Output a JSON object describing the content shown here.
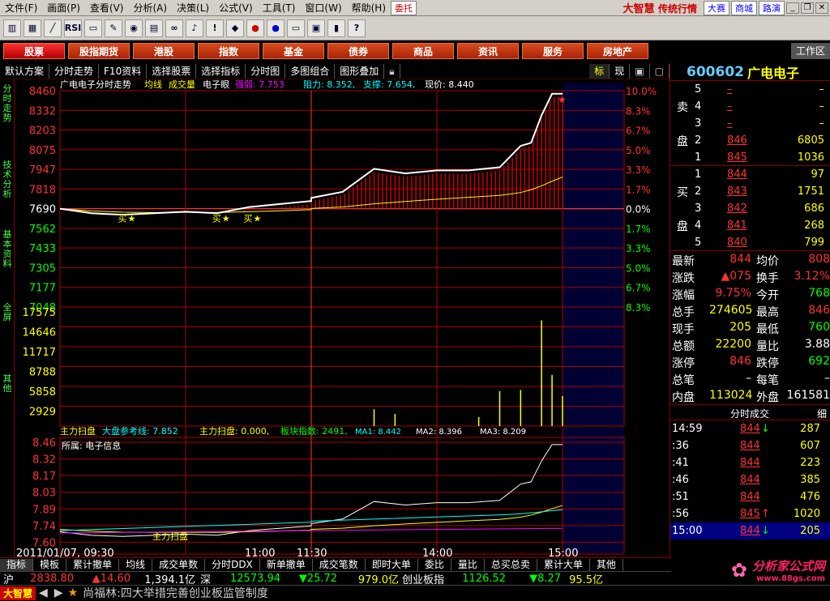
{
  "menu": [
    "文件(F)",
    "画面(P)",
    "查看(V)",
    "分析(A)",
    "决策(L)",
    "公式(V)",
    "工具(T)",
    "窗口(W)",
    "帮助(H)"
  ],
  "menu_right": {
    "entrust": "委托",
    "logo": "大智慧",
    "logo_sub": "传统行情",
    "btn1": "大赛",
    "btn2": "商城",
    "btn3": "路演"
  },
  "nav": [
    "股票",
    "股指期货",
    "港股",
    "指数",
    "基金",
    "债券",
    "商品",
    "资讯",
    "服务",
    "房地产"
  ],
  "workspace": "工作区",
  "options": [
    "默认方案",
    "分时走势",
    "F10资料",
    "选择股票",
    "选择指标",
    "分时图",
    "多图组合",
    "图形叠加"
  ],
  "side_tabs": [
    "分时走势",
    "技术分析",
    "基本资料",
    "全屏",
    "其他"
  ],
  "chart_header": {
    "a": "广电电子分时走势",
    "b": "均线",
    "c": "成交量",
    "d": "电子眼",
    "e": "强弱: 7.753",
    "f": "阻力: 8.352,",
    "g": "支撑: 7.654,",
    "h": "现价: 8.440"
  },
  "y_left_price": [
    "8460",
    "8332",
    "8203",
    "8075",
    "7947",
    "7818",
    "7690",
    "7562",
    "7433",
    "7305",
    "7177",
    "7048"
  ],
  "y_right_pct": [
    "10.0%",
    "8.3%",
    "6.7%",
    "5.0%",
    "3.3%",
    "1.7%",
    "0.0%",
    "1.7%",
    "3.3%",
    "5.0%",
    "6.7%",
    "8.3%"
  ],
  "y_vol": [
    "17575",
    "14646",
    "11717",
    "8788",
    "5858",
    "2929"
  ],
  "ind_header": {
    "a": "主力扫盘",
    "b": "大盘参考线: 7.852",
    "c": "主力扫盘: 0.000,",
    "d": "板块指数: 2491,",
    "e": "MA1: 8.442",
    "f": "MA2: 8.396",
    "g": "MA3: 8.209"
  },
  "ind_sector": "所属: 电子信息",
  "ind_label": "主力扫盘",
  "y_ind": [
    "8.46",
    "8.32",
    "8.17",
    "8.03",
    "7.89",
    "7.74",
    "7.60"
  ],
  "x_labels": [
    "2011/01/07, 09:30",
    "11:00",
    "11:30",
    "14:00",
    "15:00"
  ],
  "buy_marks": [
    "买",
    "买",
    "买"
  ],
  "quote": {
    "code": "600602",
    "name": "广电电子",
    "sell_label": [
      "卖",
      "盘"
    ],
    "buy_label": [
      "买",
      "盘"
    ],
    "asks": [
      [
        "5",
        "–",
        "–"
      ],
      [
        "4",
        "–",
        "–"
      ],
      [
        "3",
        "–",
        "–"
      ],
      [
        "2",
        "846",
        "6805"
      ],
      [
        "1",
        "845",
        "1036"
      ]
    ],
    "bids": [
      [
        "1",
        "844",
        "97"
      ],
      [
        "2",
        "843",
        "1751"
      ],
      [
        "3",
        "842",
        "686"
      ],
      [
        "4",
        "841",
        "268"
      ],
      [
        "5",
        "840",
        "799"
      ]
    ],
    "stats": [
      [
        "最新",
        "844",
        "均价",
        "808"
      ],
      [
        "涨跌",
        "▲075",
        "换手",
        "3.12%"
      ],
      [
        "涨幅",
        "9.75%",
        "今开",
        "768"
      ],
      [
        "总手",
        "274605",
        "最高",
        "846"
      ],
      [
        "现手",
        "205",
        "最低",
        "760"
      ],
      [
        "总额",
        "22200",
        "量比",
        "3.88"
      ],
      [
        "涨停",
        "846",
        "跌停",
        "692"
      ],
      [
        "总笔",
        "–",
        "每笔",
        "–"
      ],
      [
        "内盘",
        "113024",
        "外盘",
        "161581"
      ]
    ],
    "ticks_title": "分时成交",
    "ticks_tab": "细",
    "ticks": [
      [
        "14:59",
        "844",
        "↓",
        "287"
      ],
      [
        ":36",
        "844",
        "",
        "607"
      ],
      [
        ":41",
        "844",
        "",
        "223"
      ],
      [
        ":46",
        "844",
        "",
        "385"
      ],
      [
        ":51",
        "844",
        "",
        "476"
      ],
      [
        ":56",
        "845",
        "↑",
        "1020"
      ],
      [
        "15:00",
        "844",
        "↓",
        "205"
      ]
    ]
  },
  "bottom_tabs": [
    "指标",
    "模板",
    "累计撤单",
    "均线",
    "成交单数",
    "分时DDX",
    "新单撤单",
    "成交笔数",
    "即时大单",
    "委比",
    "量比",
    "总买总卖",
    "累计大单",
    "其他"
  ],
  "index_bar": {
    "sh": "沪",
    "sh_val": "2838.80",
    "sh_chg": "▲14.60",
    "sh_amt": "1,394.1亿",
    "sz": "深",
    "sz_val": "12573.94",
    "sz_chg": "▼25.72",
    "sz_amt": "979.0亿",
    "cy": "创业板指",
    "cy_val": "1126.52",
    "cy_chg": "▼8.27",
    "cy_amt": "95.5亿"
  },
  "news": {
    "brand": "大智慧",
    "text": "尚福林:四大举措完善创业板监管制度"
  },
  "watermark": "分析家公式网",
  "watermark_url": "www.88gs.com",
  "chart_data": {
    "type": "line",
    "title": "广电电子分时走势",
    "prev_close": 7.69,
    "price_series": [
      [
        "09:30",
        7.69
      ],
      [
        "09:45",
        7.66
      ],
      [
        "10:00",
        7.65
      ],
      [
        "10:15",
        7.66
      ],
      [
        "10:30",
        7.67
      ],
      [
        "10:45",
        7.66
      ],
      [
        "11:00",
        7.7
      ],
      [
        "11:15",
        7.72
      ],
      [
        "11:30",
        7.74
      ],
      [
        "13:00",
        7.76
      ],
      [
        "13:15",
        7.8
      ],
      [
        "13:30",
        7.95
      ],
      [
        "13:45",
        7.92
      ],
      [
        "14:00",
        7.94
      ],
      [
        "14:15",
        7.94
      ],
      [
        "14:30",
        7.96
      ],
      [
        "14:40",
        8.1
      ],
      [
        "14:45",
        8.12
      ],
      [
        "14:50",
        8.3
      ],
      [
        "14:55",
        8.44
      ],
      [
        "15:00",
        8.44
      ]
    ],
    "volume_series": [
      [
        "13:30",
        2800
      ],
      [
        "13:40",
        2000
      ],
      [
        "14:20",
        1500
      ],
      [
        "14:30",
        5800
      ],
      [
        "14:40",
        6000
      ],
      [
        "14:50",
        17575
      ],
      [
        "14:55",
        8500
      ],
      [
        "15:00",
        5000
      ]
    ],
    "ylim": [
      7.048,
      8.46
    ]
  }
}
